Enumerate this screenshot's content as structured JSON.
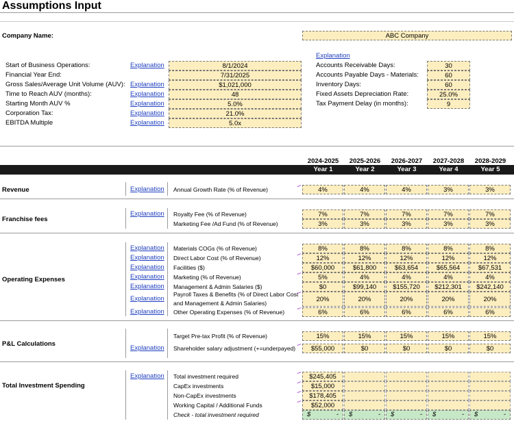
{
  "title": "Assumptions Input",
  "company": {
    "label": "Company Name:",
    "value": "ABC Company"
  },
  "explanation_text": "Explanation",
  "left_assumptions": [
    {
      "label": "Start of Business Operations:",
      "value": "8/1/2024",
      "has_link": true
    },
    {
      "label": "Financial Year End:",
      "value": "7/31/2025",
      "has_link": false
    },
    {
      "label": "Gross Sales/Average Unit Volume (AUV):",
      "value": "$1,021,000",
      "has_link": true
    },
    {
      "label": "Time to Reach AUV (months):",
      "value": "48",
      "has_link": true
    },
    {
      "label": "Starting Month AUV %",
      "value": "5.0%",
      "has_link": true
    },
    {
      "label": "Corporation Tax:",
      "value": "21.0%",
      "has_link": true
    },
    {
      "label": "EBITDA Multiple",
      "value": "5.0x",
      "has_link": true
    }
  ],
  "right_assumptions": [
    {
      "label": "Accounts Receivable Days:",
      "value": "30"
    },
    {
      "label": "Accounts Payable Days - Materials:",
      "value": "60"
    },
    {
      "label": "Inventory Days:",
      "value": "60"
    },
    {
      "label": "Fixed Assets Depreciation Rate:",
      "value": "25.0%"
    },
    {
      "label": "Tax Payment Delay (in months):",
      "value": "9"
    }
  ],
  "periods": [
    "2024-2025",
    "2025-2026",
    "2026-2027",
    "2027-2028",
    "2028-2029"
  ],
  "years": [
    "Year 1",
    "Year 2",
    "Year 3",
    "Year 4",
    "Year 5"
  ],
  "sections": {
    "revenue": "Revenue",
    "franchise": "Franchise fees",
    "opex": "Operating Expenses",
    "pl": "P&L Calculations",
    "investment": "Total Investment Spending"
  },
  "rows": {
    "revenue_growth": {
      "label": "Annual Growth Rate (% of Revenue)",
      "values": [
        "4%",
        "4%",
        "4%",
        "3%",
        "3%"
      ]
    },
    "royalty": {
      "label": "Royalty Fee (% of Revenue)",
      "values": [
        "7%",
        "7%",
        "7%",
        "7%",
        "7%"
      ]
    },
    "marketing_fee": {
      "label": "Marketing Fee /Ad Fund (% of Revenue)",
      "values": [
        "3%",
        "3%",
        "3%",
        "3%",
        "3%"
      ]
    },
    "materials": {
      "label": "Materials COGs (% of Revenue)",
      "values": [
        "8%",
        "8%",
        "8%",
        "8%",
        "8%"
      ]
    },
    "direct_labor": {
      "label": "Direct Labor Cost (% of Revenue)",
      "values": [
        "12%",
        "12%",
        "12%",
        "12%",
        "12%"
      ]
    },
    "facilities": {
      "label": "Facilities ($)",
      "values": [
        "$60,000",
        "$61,800",
        "$63,654",
        "$65,564",
        "$67,531"
      ]
    },
    "marketing": {
      "label": "Marketing (% of Revenue)",
      "values": [
        "5%",
        "4%",
        "4%",
        "4%",
        "4%"
      ]
    },
    "mgmt_salaries": {
      "label": "Management & Admin Salaries ($)",
      "values": [
        "$0",
        "$99,140",
        "$155,720",
        "$212,301",
        "$242,140"
      ]
    },
    "payroll_line1": "Payroll Taxes & Benefits (% of Direct Labor Cost",
    "payroll_line2": "and Management & Admin Salaries)",
    "payroll_values": [
      "20%",
      "20%",
      "20%",
      "20%",
      "20%"
    ],
    "other_opex": {
      "label": "Other Operating Expenses (% of Revenue)",
      "values": [
        "6%",
        "6%",
        "6%",
        "6%",
        "6%"
      ]
    },
    "target_profit": {
      "label": "Target Pre-tax Profit (% of Revenue)",
      "values": [
        "15%",
        "15%",
        "15%",
        "15%",
        "15%"
      ]
    },
    "shareholder": {
      "label": "Shareholder salary adjustment (+=underpayed)",
      "values": [
        "$55,000",
        "$0",
        "$0",
        "$0",
        "$0"
      ]
    },
    "total_investment": {
      "label": "Total investment required",
      "value": "$245,405"
    },
    "capex": {
      "label": "CapEx investments",
      "value": "$15,000"
    },
    "noncapex": {
      "label": "Non-CapEx investments",
      "value": "$178,405"
    },
    "working_capital": {
      "label": "Working Capital / Additional Funds",
      "value": "$52,000"
    },
    "check": {
      "label": "Check - total investment required",
      "symbol": "$",
      "dash": "-"
    }
  }
}
